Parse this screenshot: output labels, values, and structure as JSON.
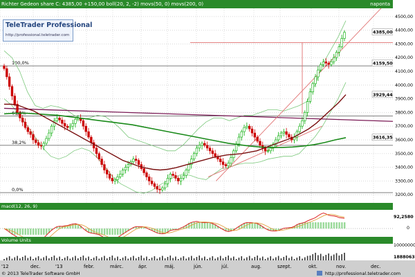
{
  "header": {
    "title": "Richter Gedeon share C: 4385,00 +150,00 boll(20, 2, -2) movs(50, 0) movs(200, 0)",
    "period": "naponta"
  },
  "logo": {
    "name": "TeleTrader Professional",
    "url": "http://professional.teletrader.com"
  },
  "macd_header": "macd(12, 26, 9)",
  "volume_header": "Volume Units",
  "footer": {
    "copyright": "© 2013 TeleTrader Software GmbH",
    "website": "http://professional.teletrader.com"
  },
  "colors": {
    "price_up": "#00aa00",
    "price_down": "#cc0000",
    "bollinger": "#7bc87b",
    "ma50": "#7a1010",
    "ma200": "#1a8a1a",
    "trend_red": "#e07070",
    "fib": "#7a1a55",
    "header_bg": "#2a8a2a",
    "macd": "#dd2222",
    "macd_signal": "#e0a040",
    "macd_hist": "#80d080"
  },
  "chart_data": {
    "type": "candlestick",
    "title": "Richter Gedeon share",
    "x_ticks": [
      "'12",
      "dec.",
      "'13",
      "febr.",
      "márc.",
      "ápr.",
      "máj.",
      "jún.",
      "júl.",
      "aug.",
      "szept.",
      "okt.",
      "nov.",
      "dec."
    ],
    "y_ticks": [
      "3200,00",
      "3300,00",
      "3400,00",
      "3500,00",
      "3600,00",
      "3700,00",
      "3800,00",
      "3900,00",
      "4000,00",
      "4100,00",
      "4200,00",
      "4300,00",
      "4400,00",
      "4500,00"
    ],
    "ylim": [
      3140,
      4560
    ],
    "fib_levels": [
      {
        "label": "100,0%",
        "value": 4140
      },
      {
        "label": "61,8%",
        "value": 3775
      },
      {
        "label": "38,2%",
        "value": 3560
      },
      {
        "label": "0,0%",
        "value": 3215
      }
    ],
    "callouts": [
      {
        "label": "4385,00",
        "value": 4385
      },
      {
        "label": "4159,50",
        "value": 4159.5
      },
      {
        "label": "3929,44",
        "value": 3929.44
      },
      {
        "label": "3616,35",
        "value": 3616.35
      }
    ],
    "closes": [
      4120,
      4060,
      3990,
      3920,
      3860,
      3800,
      3760,
      3730,
      3690,
      3660,
      3640,
      3600,
      3580,
      3560,
      3555,
      3575,
      3610,
      3650,
      3700,
      3740,
      3760,
      3745,
      3720,
      3700,
      3690,
      3700,
      3720,
      3750,
      3760,
      3740,
      3700,
      3660,
      3620,
      3580,
      3540,
      3500,
      3460,
      3420,
      3380,
      3350,
      3320,
      3300,
      3310,
      3330,
      3350,
      3380,
      3400,
      3420,
      3440,
      3460,
      3450,
      3420,
      3390,
      3360,
      3330,
      3300,
      3280,
      3260,
      3240,
      3235,
      3250,
      3280,
      3320,
      3350,
      3340,
      3320,
      3300,
      3320,
      3340,
      3380,
      3420,
      3460,
      3500,
      3540,
      3560,
      3575,
      3560,
      3540,
      3520,
      3500,
      3480,
      3460,
      3440,
      3420,
      3410,
      3430,
      3470,
      3520,
      3570,
      3620,
      3660,
      3690,
      3700,
      3680,
      3650,
      3620,
      3590,
      3560,
      3540,
      3520,
      3520,
      3540,
      3570,
      3600,
      3630,
      3650,
      3660,
      3640,
      3620,
      3600,
      3620,
      3660,
      3700,
      3740,
      3800,
      3880,
      3950,
      4010,
      4060,
      4110,
      4150,
      4170,
      4160,
      4150,
      4170,
      4200,
      4240,
      4280,
      4340,
      4385
    ],
    "ma50": [
      3860,
      3860,
      3850,
      3830,
      3810,
      3780,
      3750,
      3720,
      3690,
      3660,
      3630,
      3600,
      3570,
      3540,
      3510,
      3480,
      3450,
      3430,
      3410,
      3395,
      3385,
      3380,
      3385,
      3395,
      3410,
      3425,
      3440,
      3455,
      3470,
      3480,
      3490,
      3495,
      3500,
      3510,
      3520,
      3540,
      3560,
      3580,
      3600,
      3620,
      3650,
      3680,
      3720,
      3770,
      3820,
      3870,
      3930
    ],
    "ma200": [
      3790,
      3795,
      3795,
      3790,
      3785,
      3780,
      3770,
      3760,
      3750,
      3740,
      3730,
      3720,
      3710,
      3695,
      3680,
      3665,
      3650,
      3635,
      3620,
      3605,
      3590,
      3575,
      3565,
      3555,
      3548,
      3545,
      3545,
      3548,
      3555,
      3565,
      3580,
      3600,
      3616
    ],
    "bb_upper": [
      4250,
      4200,
      4100,
      3950,
      3850,
      3830,
      3850,
      3840,
      3820,
      3780,
      3750,
      3760,
      3780,
      3770,
      3730,
      3680,
      3620,
      3600,
      3580,
      3560,
      3540,
      3520,
      3520,
      3560,
      3620,
      3680,
      3730,
      3760,
      3760,
      3740,
      3760,
      3780,
      3780,
      3800,
      3820,
      3820,
      3810,
      3830,
      3850,
      3880,
      4000,
      4150,
      4250,
      4350,
      4470
    ],
    "bb_lower": [
      3900,
      3850,
      3780,
      3700,
      3620,
      3540,
      3480,
      3460,
      3480,
      3520,
      3540,
      3520,
      3470,
      3400,
      3330,
      3280,
      3250,
      3220,
      3210,
      3230,
      3270,
      3300,
      3330,
      3350,
      3340,
      3320,
      3310,
      3350,
      3390,
      3400,
      3420,
      3430,
      3430,
      3440,
      3460,
      3470,
      3480,
      3480,
      3500,
      3560,
      3620,
      3700,
      3800,
      3900,
      4020
    ],
    "trend_line_1": {
      "from": [
        0.55,
        3300
      ],
      "to": [
        0.97,
        4560
      ]
    },
    "trend_line_2": {
      "from": [
        0.53,
        3330
      ],
      "to": [
        0.82,
        3700
      ]
    },
    "resistance": 4310,
    "macd": {
      "zero": 0,
      "last": 92.258
    }
  },
  "y_axis_macd": [
    "92,2580",
    "0"
  ],
  "y_axis_vol": [
    "10000000",
    "1888063"
  ]
}
